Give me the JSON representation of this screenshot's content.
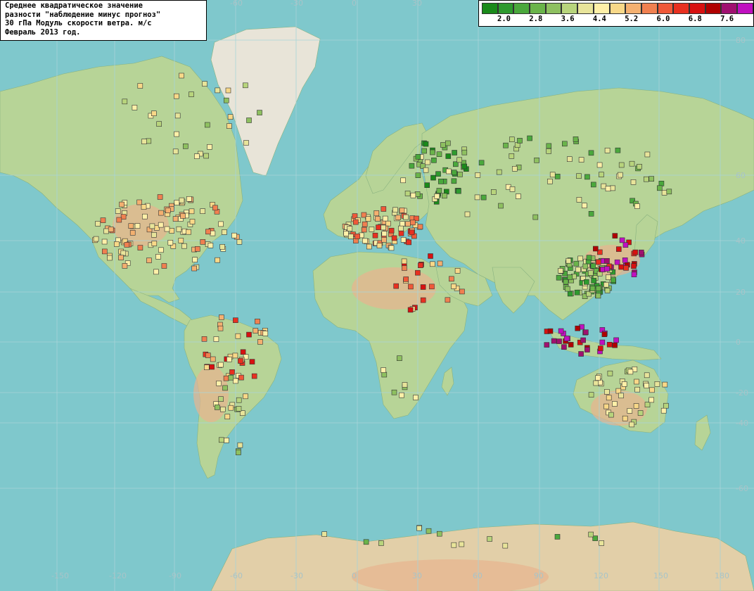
{
  "title_lines": [
    "Среднее квадратическое значение",
    "разности \"наблюдение минус прогноз\"",
    "30 гПа Модуль скорости ветра. м/с",
    "Февраль 2013 год."
  ],
  "legend": {
    "colors": [
      "#1a8a1a",
      "#2e9a2e",
      "#4aa83c",
      "#6ab44a",
      "#8ec060",
      "#b8d47c",
      "#e8e49a",
      "#fff0a8",
      "#f8d888",
      "#f4b070",
      "#f08050",
      "#f05838",
      "#e83020",
      "#d81010",
      "#b00000",
      "#a01070",
      "#c010c0"
    ],
    "labels": [
      "2.0",
      "2.8",
      "3.6",
      "4.4",
      "5.2",
      "6.0",
      "6.8",
      "7.6"
    ]
  },
  "axis_ticks": {
    "lon": [
      "-150",
      "-120",
      "-90",
      "-60",
      "-30",
      "0",
      "30",
      "60",
      "90",
      "120",
      "150",
      "180"
    ],
    "lon_top": [
      "-60",
      "-30",
      "0",
      "30"
    ],
    "lat": [
      "80",
      "60",
      "40",
      "20",
      "0",
      "-20",
      "-40",
      "-60"
    ]
  }
}
